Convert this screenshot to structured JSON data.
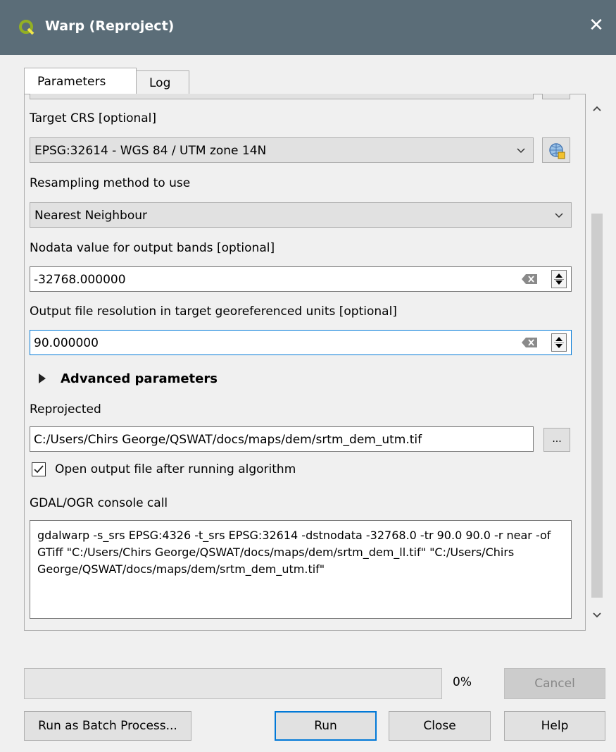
{
  "window": {
    "title": "Warp (Reproject)",
    "accent": "#5b6d78"
  },
  "tabs": [
    {
      "label": "Parameters",
      "active": true
    },
    {
      "label": "Log",
      "active": false
    }
  ],
  "target_crs": {
    "label": "Target CRS [optional]",
    "value": "EPSG:32614 - WGS 84 / UTM zone 14N"
  },
  "resampling": {
    "label": "Resampling method to use",
    "value": "Nearest Neighbour"
  },
  "nodata": {
    "label": "Nodata value for output bands [optional]",
    "value": "-32768.000000"
  },
  "resolution": {
    "label": "Output file resolution in target georeferenced units [optional]",
    "value": "90.000000"
  },
  "advanced": {
    "label": "Advanced parameters"
  },
  "output": {
    "label": "Reprojected",
    "value": "C:/Users/Chirs George/QSWAT/docs/maps/dem/srtm_dem_utm.tif",
    "browse_label": "..."
  },
  "open_output": {
    "label": "Open output file after running algorithm",
    "checked": true
  },
  "console": {
    "label": "GDAL/OGR console call",
    "text": "gdalwarp -s_srs EPSG:4326 -t_srs EPSG:32614 -dstnodata -32768.0 -tr 90.0 90.0 -r near -of GTiff \"C:/Users/Chirs George/QSWAT/docs/maps/dem/srtm_dem_ll.tif\" \"C:/Users/Chirs George/QSWAT/docs/maps/dem/srtm_dem_utm.tif\""
  },
  "progress": {
    "percent_label": "0%",
    "value": 0
  },
  "buttons": {
    "cancel": "Cancel",
    "batch": "Run as Batch Process...",
    "run": "Run",
    "close": "Close",
    "help": "Help"
  }
}
